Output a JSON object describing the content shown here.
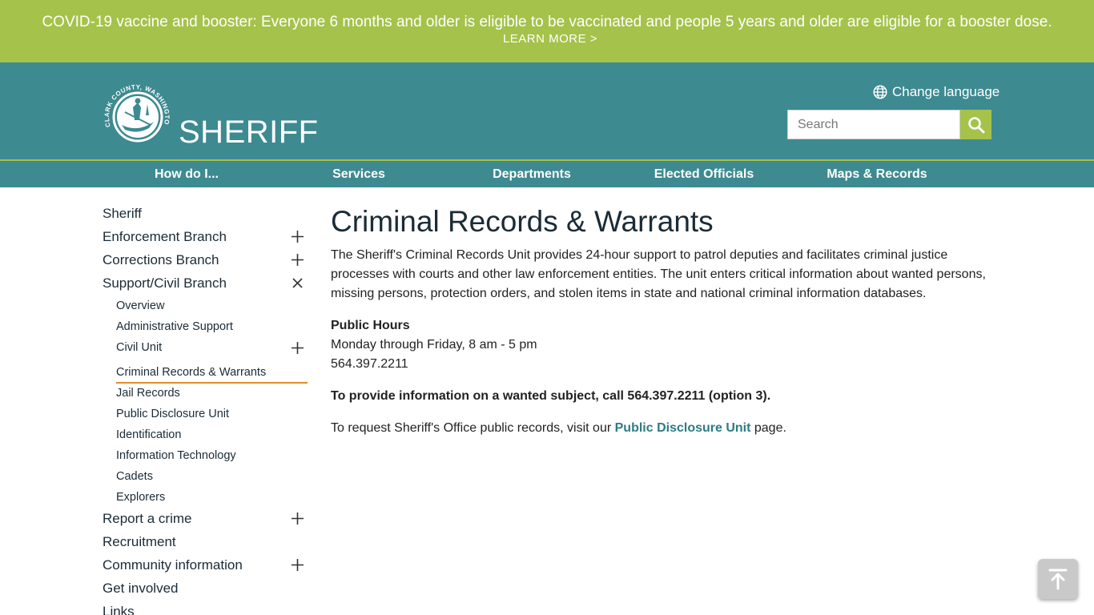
{
  "alert": {
    "text": "COVID-19 vaccine and booster: Everyone 6 months and older is eligible to be vaccinated and people 5 years and older are eligible for a booster dose.",
    "link": "LEARN MORE >"
  },
  "header": {
    "logo_ring_text": "CLARK COUNTY, WASHINGTON",
    "logo_word": "SHERIFF",
    "language_label": "Change language",
    "search_placeholder": "Search"
  },
  "nav": [
    "How do I...",
    "Services",
    "Departments",
    "Elected Officials",
    "Maps & Records"
  ],
  "sidebar": {
    "top_items": [
      {
        "label": "Sheriff",
        "toggle": "none"
      },
      {
        "label": "Enforcement Branch",
        "toggle": "plus"
      },
      {
        "label": "Corrections Branch",
        "toggle": "plus"
      },
      {
        "label": "Support/Civil Branch",
        "toggle": "close"
      }
    ],
    "sub_items": [
      {
        "label": "Overview",
        "toggle": "none"
      },
      {
        "label": "Administrative Support",
        "toggle": "none"
      },
      {
        "label": "Civil Unit",
        "toggle": "plus"
      },
      {
        "label": "Criminal Records & Warrants",
        "toggle": "none",
        "active": true
      },
      {
        "label": "Jail Records",
        "toggle": "none"
      },
      {
        "label": "Public Disclosure Unit",
        "toggle": "none"
      },
      {
        "label": "Identification",
        "toggle": "none"
      },
      {
        "label": "Information Technology",
        "toggle": "none"
      },
      {
        "label": "Cadets",
        "toggle": "none"
      },
      {
        "label": "Explorers",
        "toggle": "none"
      }
    ],
    "bottom_items": [
      {
        "label": "Report a crime",
        "toggle": "plus"
      },
      {
        "label": "Recruitment",
        "toggle": "none"
      },
      {
        "label": "Community information",
        "toggle": "plus"
      },
      {
        "label": "Get involved",
        "toggle": "none"
      },
      {
        "label": "Links",
        "toggle": "none"
      }
    ]
  },
  "content": {
    "title": "Criminal Records & Warrants",
    "intro": "The Sheriff's Criminal Records Unit provides 24-hour support to patrol deputies and facilitates criminal justice processes with courts and other law enforcement entities. The unit enters critical information about wanted persons, missing persons, protection orders, and stolen items in state and national criminal information databases.",
    "hours_title": "Public Hours",
    "hours_days": "Monday through Friday, 8 am - 5 pm",
    "phone": "564.397.2211",
    "notice": "To provide information on a wanted subject, call 564.397.2211 (option 3).",
    "request_before": "To request Sheriff's Office public records, visit our ",
    "request_link": "Public Disclosure Unit",
    "request_after": " page."
  },
  "colors": {
    "accent_green": "#a5c24a",
    "header_teal": "#3d8a91",
    "active_underline": "#e28d2a",
    "link_teal": "#2e7c83"
  },
  "icons": {
    "language": "globe-icon",
    "search": "search-icon",
    "expand": "plus-icon",
    "collapse": "close-icon",
    "back_to_top": "arrow-up-to-line-icon"
  }
}
